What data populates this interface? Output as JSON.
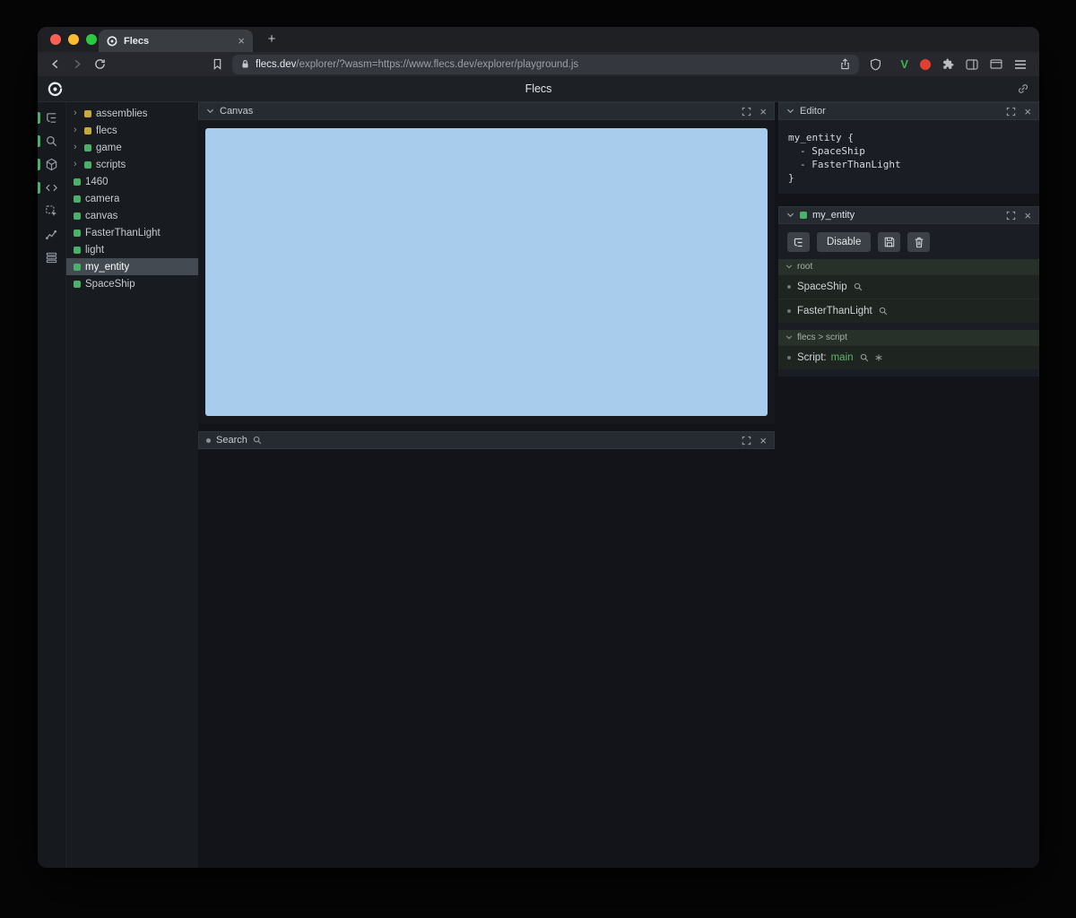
{
  "colors": {
    "green": "#4cb06a",
    "yellow": "#c9a93c",
    "canvas_blue": "#a8cdec",
    "value_green": "#5db36d",
    "ext_green": "#41b14f"
  },
  "browser": {
    "tab_title": "Flecs",
    "url_domain": "flecs.dev",
    "url_path": "/explorer/?wasm=https://www.flecs.dev/explorer/playground.js",
    "extension_v_label": "V"
  },
  "app": {
    "title": "Flecs"
  },
  "tree": {
    "items": [
      {
        "label": "assemblies",
        "type": "yellow",
        "expandable": true,
        "selected": false
      },
      {
        "label": "flecs",
        "type": "yellow",
        "expandable": true,
        "selected": false
      },
      {
        "label": "game",
        "type": "green",
        "expandable": true,
        "selected": false
      },
      {
        "label": "scripts",
        "type": "green",
        "expandable": true,
        "selected": false
      },
      {
        "label": "1460",
        "type": "green",
        "expandable": false,
        "selected": false
      },
      {
        "label": "camera",
        "type": "green",
        "expandable": false,
        "selected": false
      },
      {
        "label": "canvas",
        "type": "green",
        "expandable": false,
        "selected": false
      },
      {
        "label": "FasterThanLight",
        "type": "green",
        "expandable": false,
        "selected": false
      },
      {
        "label": "light",
        "type": "green",
        "expandable": false,
        "selected": false
      },
      {
        "label": "my_entity",
        "type": "green",
        "expandable": false,
        "selected": true
      },
      {
        "label": "SpaceShip",
        "type": "green",
        "expandable": false,
        "selected": false
      }
    ]
  },
  "panels": {
    "canvas": {
      "title": "Canvas"
    },
    "search": {
      "title": "Search"
    },
    "editor": {
      "title": "Editor",
      "code": [
        {
          "text": "my_entity {",
          "indent": 0
        },
        {
          "text": "- SpaceShip",
          "indent": 1
        },
        {
          "text": "- FasterThanLight",
          "indent": 1
        },
        {
          "text": "}",
          "indent": 0
        }
      ]
    },
    "inspector": {
      "title": "my_entity",
      "buttons": {
        "disable": "Disable"
      },
      "sections": [
        {
          "title": "root",
          "rows": [
            {
              "label": "SpaceShip"
            },
            {
              "label": "FasterThanLight"
            }
          ]
        },
        {
          "title": "flecs > script",
          "rows": [
            {
              "label": "Script:",
              "value": "main"
            }
          ]
        }
      ]
    }
  }
}
